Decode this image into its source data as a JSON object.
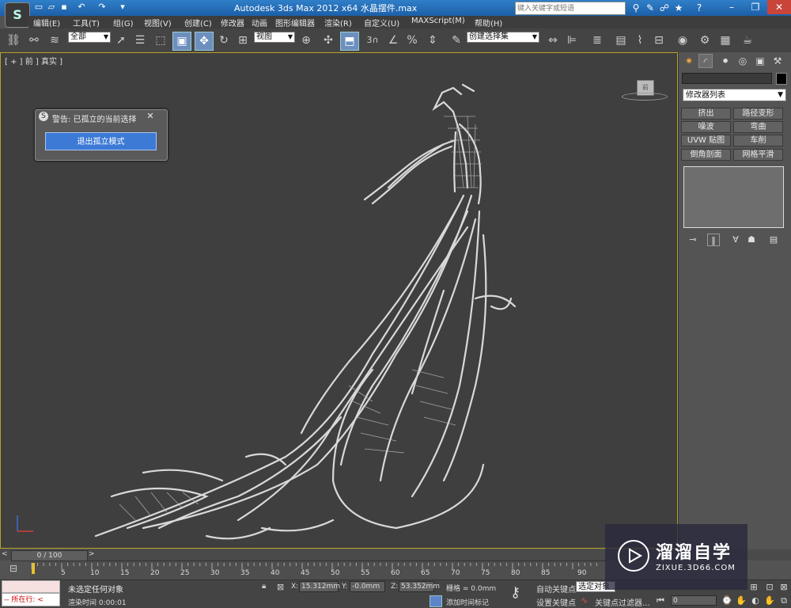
{
  "window": {
    "title": "Autodesk 3ds Max  2012 x64     水晶摆件.max",
    "search_placeholder": "键入关键字或短语"
  },
  "menu": [
    "编辑(E)",
    "工具(T)",
    "组(G)",
    "视图(V)",
    "创建(C)",
    "修改器",
    "动画",
    "图形编辑器",
    "渲染(R)",
    "自定义(U)",
    "MAXScript(M)",
    "帮助(H)"
  ],
  "toolbar": {
    "selection_filter": "全部",
    "ref_coord": "视图",
    "named_selection": "创建选择集",
    "snap_label": "3"
  },
  "viewport": {
    "label": "[ + ] 前 ] 真实 ]",
    "viewcube_label": "前"
  },
  "dialog": {
    "title": "警告: 已孤立的当前选择",
    "button": "退出孤立模式"
  },
  "command_panel": {
    "modifier_list": "修改器列表",
    "modifier_buttons": [
      "挤出",
      "路径变形",
      "噪波",
      "弯曲",
      "UVW 贴图",
      "车削",
      "倒角剖面",
      "网格平滑"
    ]
  },
  "timeline": {
    "frame_display": "0 / 100",
    "ticks": [
      "5",
      "10",
      "15",
      "20",
      "25",
      "30",
      "35",
      "40",
      "45",
      "50",
      "55",
      "60",
      "65",
      "70",
      "75",
      "80",
      "85",
      "90"
    ]
  },
  "status": {
    "selection": "未选定任何对象",
    "render_time": "渲染时间  0:00:01",
    "maxscript_text": "-- 所在行: <",
    "x_label": "X:",
    "x_value": "15.312mm",
    "y_label": "Y:",
    "y_value": "-0.0mm",
    "z_label": "Z:",
    "z_value": "53.352mm",
    "grid": "栅格 = 0.0mm",
    "add_time_tag": "添加时间标记",
    "auto_key": "自动关键点",
    "set_key": "设置关键点",
    "selected_dropdown": "选定对象",
    "key_filters": "关键点过滤器...",
    "current_frame": "0"
  },
  "watermark": {
    "title": "溜溜自学",
    "url": "ZIXUE.3D66.COM"
  }
}
